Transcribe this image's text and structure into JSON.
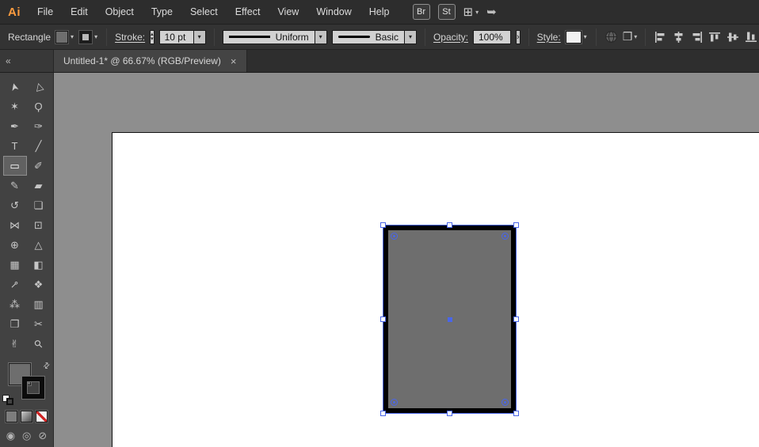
{
  "app": {
    "logo_text": "Ai",
    "brand_orange": "#ff9c3f"
  },
  "menubar": {
    "items": [
      "File",
      "Edit",
      "Object",
      "Type",
      "Select",
      "Effect",
      "View",
      "Window",
      "Help"
    ],
    "bridge_button": "Br",
    "stock_button": "St"
  },
  "control_bar": {
    "context_label": "Rectangle",
    "stroke_label": "Stroke:",
    "stroke_weight": "10 pt",
    "profile_name": "Uniform",
    "brush_name": "Basic",
    "opacity_label": "Opacity:",
    "opacity_value": "100%",
    "style_label": "Style:"
  },
  "tab_bar": {
    "collapse_glyph": "«",
    "tab_title": "Untitled-1* @ 66.67% (RGB/Preview)",
    "close_glyph": "×"
  },
  "icons": {
    "chevron_down": "▾",
    "chevron_up": "▴",
    "panel_arrow": "›",
    "arrange_grid": "⊞",
    "sync": "➥",
    "doc_setup": "❒",
    "swap": "⇄"
  },
  "toolbar": {
    "tools": [
      {
        "name": "selection",
        "glyph": "➤",
        "cls": "arrow"
      },
      {
        "name": "direct-selection",
        "glyph": "▷",
        "cls": "arrow"
      },
      {
        "name": "magic-wand",
        "glyph": "✶"
      },
      {
        "name": "lasso",
        "glyph": "Ϙ"
      },
      {
        "name": "pen",
        "glyph": "✒"
      },
      {
        "name": "curvature",
        "glyph": "✑"
      },
      {
        "name": "type",
        "glyph": "T"
      },
      {
        "name": "line-segment",
        "glyph": "╱"
      },
      {
        "name": "rectangle",
        "glyph": "▭",
        "selected": true
      },
      {
        "name": "paintbrush",
        "glyph": "✐"
      },
      {
        "name": "shaper",
        "glyph": "✎"
      },
      {
        "name": "eraser",
        "glyph": "▰"
      },
      {
        "name": "rotate",
        "glyph": "↺"
      },
      {
        "name": "scale",
        "glyph": "❏"
      },
      {
        "name": "width",
        "glyph": "⋈"
      },
      {
        "name": "free-transform",
        "glyph": "⊡"
      },
      {
        "name": "shape-builder",
        "glyph": "⊕"
      },
      {
        "name": "perspective-grid",
        "glyph": "△"
      },
      {
        "name": "mesh",
        "glyph": "▦"
      },
      {
        "name": "gradient",
        "glyph": "◧"
      },
      {
        "name": "eyedropper",
        "glyph": "⊸",
        "cls": "rot45"
      },
      {
        "name": "blend",
        "glyph": "❖"
      },
      {
        "name": "symbol-sprayer",
        "glyph": "⁂"
      },
      {
        "name": "column-graph",
        "glyph": "▥"
      },
      {
        "name": "artboard",
        "glyph": "❐"
      },
      {
        "name": "slice",
        "glyph": "✂"
      },
      {
        "name": "hand",
        "glyph": "✌"
      },
      {
        "name": "zoom",
        "glyph": "⚲",
        "cls": "rot45"
      }
    ],
    "draw_modes": [
      "◉",
      "◎",
      "⊘"
    ]
  },
  "document": {
    "selected_object": {
      "type": "rectangle",
      "fill": "#6e6e6e",
      "stroke_color": "#000000",
      "stroke_weight": "10 pt"
    }
  },
  "colors": {
    "selection_blue": "#4a66e8",
    "pasteboard": "#8e8e8e",
    "artboard": "#ffffff",
    "panel_dark": "#333333"
  }
}
